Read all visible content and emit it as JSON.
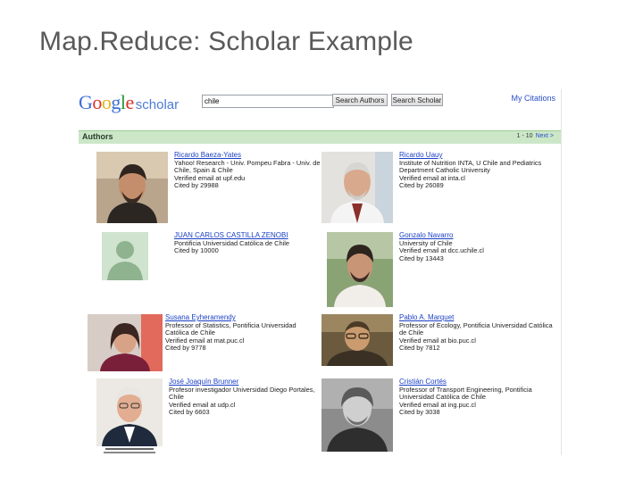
{
  "slide": {
    "title": "Map.Reduce: Scholar Example"
  },
  "header": {
    "logo_google": "Google",
    "logo_scholar": "scholar",
    "search_value": "chile",
    "search_authors_label": "Search Authors",
    "search_scholar_label": "Search Scholar",
    "my_citations": "My Citations"
  },
  "authors_bar": {
    "title": "Authors",
    "range": "1 - 10",
    "next": "Next >"
  },
  "authors": [
    {
      "name": "Ricardo Baeza-Yates",
      "lines": [
        "Yahoo! Research - Univ. Pompeu Fabra - Univ. de Chile, Spain & Chile",
        "Verified email at upf.edu"
      ],
      "cited": "Cited by 29988",
      "photo_kind": "man-dark"
    },
    {
      "name": "Ricardo Uauy",
      "lines": [
        "Institute of Nutrition INTA, U Chile and Pediatrics",
        "Department Catholic University",
        "Verified email at inta.cl"
      ],
      "cited": "Cited by 26089",
      "photo_kind": "man-grey"
    },
    {
      "name": "JUAN CARLOS CASTILLA ZENOBI",
      "lines": [
        "Pontificia Universidad Católica de Chile"
      ],
      "cited": "Cited by 10000",
      "photo_kind": "placeholder"
    },
    {
      "name": "Gonzalo Navarro",
      "lines": [
        "University of Chile",
        "Verified email at dcc.uchile.cl"
      ],
      "cited": "Cited by 13443",
      "photo_kind": "man-dark"
    },
    {
      "name": "Susana Eyheramendy",
      "lines": [
        "Professor of Statistics, Pontificia Universidad Católica de Chile",
        "Verified email at mat.puc.cl"
      ],
      "cited": "Cited by 9778",
      "photo_kind": "woman"
    },
    {
      "name": "Pablo A. Marquet",
      "lines": [
        "Professor of Ecology, Pontificia Universidad Católica de Chile",
        "Verified email at bio.puc.cl"
      ],
      "cited": "Cited by 7812",
      "photo_kind": "man-sepia"
    },
    {
      "name": "José Joaquín Brunner",
      "lines": [
        "Profesor investigador Universidad Diego Portales, Chile",
        "Verified email at udp.cl"
      ],
      "cited": "Cited by 6603",
      "photo_kind": "man-old"
    },
    {
      "name": "Cristián Cortés",
      "lines": [
        "Professor of Transport Engineering, Pontificia Universidad Católica de Chile",
        "Verified email at ing.puc.cl"
      ],
      "cited": "Cited by 3038",
      "photo_kind": "man-bw"
    }
  ]
}
